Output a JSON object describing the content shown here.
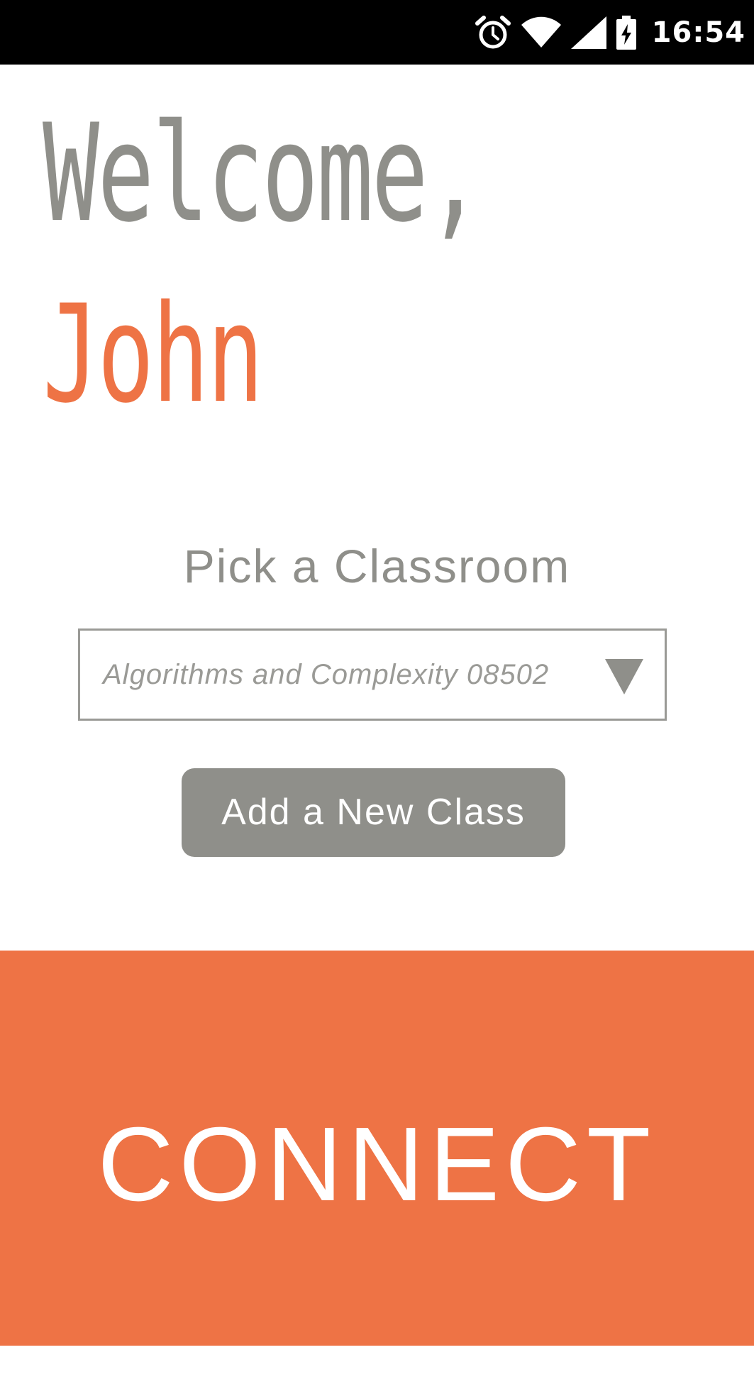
{
  "status_bar": {
    "time": "16:54",
    "icons": [
      "alarm-icon",
      "wifi-icon",
      "cell-signal-icon",
      "battery-charging-icon"
    ]
  },
  "greeting": {
    "welcome": "Welcome,",
    "name": "John"
  },
  "classroom": {
    "title": "Pick a Classroom",
    "selected": "Algorithms and Complexity 08502"
  },
  "actions": {
    "add_class_label": "Add a New Class",
    "connect_label": "CONNECT"
  },
  "colors": {
    "accent": "#ee7345",
    "gray": "#8f8f8a",
    "status_bar_bg": "#000000",
    "background": "#ffffff"
  }
}
